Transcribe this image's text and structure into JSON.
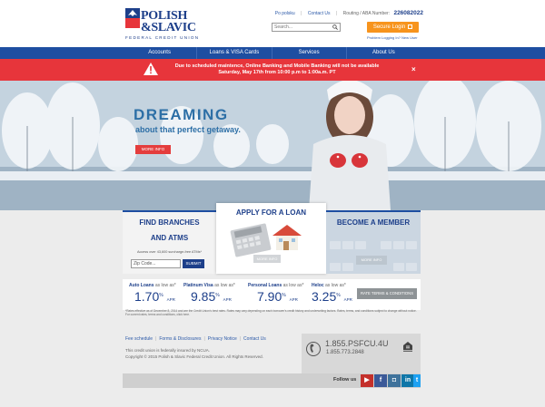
{
  "brand": {
    "name_line1": "POLISH",
    "name_line2": "&SLAVIC",
    "tagline": "FEDERAL CREDIT UNION"
  },
  "top_links": {
    "po_polsku": "Po polsku",
    "contact": "Contact Us",
    "routing_label": "Routing / ABA Number:",
    "routing_number": "226082022"
  },
  "search": {
    "placeholder": "Search..."
  },
  "login": {
    "label": "Secure Login",
    "help": "Problem Logging In?  New User"
  },
  "nav": {
    "items": [
      {
        "label": "Accounts"
      },
      {
        "label": "Loans & VISA Cards"
      },
      {
        "label": "Services"
      },
      {
        "label": "About Us"
      }
    ]
  },
  "alert": {
    "text": "Due to scheduled maintence, Online Banking and Mobile Banking will not be available Saturday, May 17th from 10:00 p.m to 1:00a.m. PT",
    "close": "×"
  },
  "hero": {
    "title": "DREAMING",
    "subtitle": "about that perfect getaway.",
    "button": "MORE INFO"
  },
  "panels": {
    "branches": {
      "title_line1": "FIND BRANCHES",
      "title_line2": "AND ATMS",
      "note": "Access over 43,600 surcharge-free ATMs*",
      "zip_placeholder": "Zip Code...",
      "submit": "SUBMIT"
    },
    "loan": {
      "title": "APPLY FOR A LOAN",
      "button": "MORE INFO"
    },
    "member": {
      "title": "BECOME A MEMBER",
      "button": "MORE INFO"
    }
  },
  "rates": {
    "items": [
      {
        "label": "Auto Loans",
        "as_low": "as low as*",
        "value": "1.70",
        "pct": "%",
        "apr": "APR"
      },
      {
        "label": "Platinum Visa",
        "as_low": "as low as*",
        "value": "9.85",
        "pct": "%",
        "apr": "APR"
      },
      {
        "label": "Personal Loans",
        "as_low": "as low as*",
        "value": "7.90",
        "pct": "%",
        "apr": "APR"
      },
      {
        "label": "Heloc",
        "as_low": "as low as*",
        "value": "3.25",
        "pct": "%",
        "apr": "APR"
      }
    ],
    "button": "RATE TERMS & CONDITIONS"
  },
  "disclaimer": "*Rates effective as of December 8, 2014 and are the Credit Union's best rates. Rates may vary depending on each borrower's credit history and underwriting factors. Rates, terms, and conditions subject to change without notice. For current rates, terms and conditions, click here.",
  "footer": {
    "links": [
      "Fee schedule",
      "Forms & Disclosures",
      "Privacy Notice",
      "Contact Us"
    ],
    "ncua": "This credit union is federally insured by NCUA.",
    "copyright": "Copyright © 2015 Polish & Slavic Federal Credit Union. All Rights Reserved.",
    "phone1": "1.855.PSFCU.4U",
    "phone2": "1.855.773.2848"
  },
  "social": {
    "follow": "Follow us",
    "items": [
      {
        "icon": "youtube-icon",
        "glyph": "▶",
        "color": "#c4302b"
      },
      {
        "icon": "facebook-icon",
        "glyph": "f",
        "color": "#3b5998"
      },
      {
        "icon": "instagram-icon",
        "glyph": "◘",
        "color": "#3f729b"
      },
      {
        "icon": "linkedin-icon",
        "glyph": "in",
        "color": "#0e76a8"
      },
      {
        "icon": "twitter-icon",
        "glyph": "t",
        "color": "#1da1f2"
      }
    ]
  },
  "colors": {
    "brand_blue": "#1e4ea1",
    "alert_red": "#e7353b",
    "login_orange": "#f7941d",
    "hero_button_red": "#e43d3d"
  }
}
